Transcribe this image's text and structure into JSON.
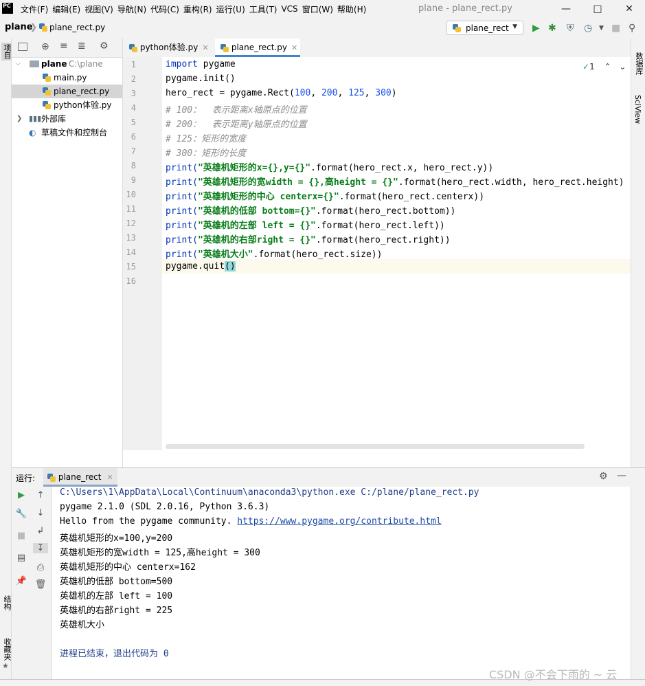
{
  "menu": [
    "文件(F)",
    "编辑(E)",
    "视图(V)",
    "导航(N)",
    "代码(C)",
    "重构(R)",
    "运行(U)",
    "工具(T)",
    "VCS",
    "窗口(W)",
    "帮助(H)"
  ],
  "window_title": "plane - plane_rect.py",
  "logo": "PC",
  "breadcrumb": {
    "project": "plane",
    "file": "plane_rect.py"
  },
  "run_config": "plane_rect",
  "left_strip": {
    "project": "项目",
    "structure": "结构",
    "favorites": "收藏夹"
  },
  "right_strip": {
    "database": "数据库",
    "sciview": "SciView"
  },
  "tree": {
    "root": "plane",
    "root_path": "C:\\plane",
    "files": [
      "main.py",
      "plane_rect.py",
      "python体验.py"
    ],
    "external": "外部库",
    "scratch": "草稿文件和控制台"
  },
  "tabs": [
    "python体验.py",
    "plane_rect.py"
  ],
  "inspection": "1",
  "line_numbers": [
    "1",
    "2",
    "3",
    "4",
    "5",
    "6",
    "7",
    "8",
    "9",
    "10",
    "11",
    "12",
    "13",
    "14",
    "15",
    "16"
  ],
  "code": {
    "l1_kw": "import",
    "l1_rest": " pygame",
    "l2": "pygame.init()",
    "l3_a": "hero_rect = pygame.Rect(",
    "l3_n1": "100",
    "l3_c1": ", ",
    "l3_n2": "200",
    "l3_c2": ", ",
    "l3_n3": "125",
    "l3_c3": ", ",
    "l3_n4": "300",
    "l3_e": ")",
    "l4": "# 100：  表示距离x轴原点的位置",
    "l5": "# 200：  表示距离y轴原点的位置",
    "l6": "# 125：矩形的宽度",
    "l7": "# 300：矩形的长度",
    "l8_s": "\"英雄机矩形的x={},y={}\"",
    "l8_r": ".format(hero_rect.x, hero_rect.y))",
    "l9_s": "\"英雄机矩形的宽width = {},高height = {}\"",
    "l9_r": ".format(hero_rect.width, hero_rect.height)",
    "l10_s": "\"英雄机矩形的中心 centerx={}\"",
    "l10_r": ".format(hero_rect.centerx))",
    "l11_s": "\"英雄机的低部 bottom={}\"",
    "l11_r": ".format(hero_rect.bottom))",
    "l12_s": "\"英雄机的左部 left = {}\"",
    "l12_r": ".format(hero_rect.left))",
    "l13_s": "\"英雄机的右部right = {}\"",
    "l13_r": ".format(hero_rect.right))",
    "l14_s": "\"英雄机大小\"",
    "l14_r": ".format(hero_rect.size))",
    "l15_a": "pygame.quit",
    "l15_b": "()",
    "print": "print("
  },
  "run_panel": {
    "label": "运行:",
    "tab": "plane_rect"
  },
  "console": [
    "C:\\Users\\1\\AppData\\Local\\Continuum\\anaconda3\\python.exe C:/plane/plane_rect.py",
    "pygame 2.1.0 (SDL 2.0.16, Python 3.6.3)",
    "英雄机矩形的x=100,y=200",
    "英雄机矩形的宽width = 125,高height = 300",
    "英雄机矩形的中心 centerx=162",
    "英雄机的低部 bottom=500",
    "英雄机的左部 left = 100",
    "英雄机的右部right = 225",
    "英雄机大小",
    "进程已结束，退出代码为 0"
  ],
  "console_hello": "Hello from the pygame community. ",
  "console_link": "https://www.pygame.org/contribute.html",
  "watermark": "CSDN @不会下雨的 ~ 云"
}
